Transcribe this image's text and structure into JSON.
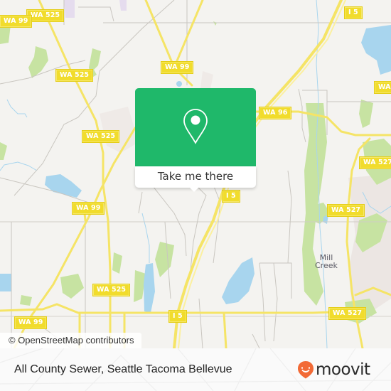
{
  "map": {
    "colors": {
      "background": "#f4f3f0",
      "water": "#a8d5ee",
      "park": "#c7e3a2",
      "major_road": "#f5e466",
      "minor_road": "#c9c6c0",
      "urban": "#ece6e3",
      "label_bg": "#f1dc2c"
    },
    "road_labels": [
      {
        "id": "wa525-top",
        "text": "WA 525"
      },
      {
        "id": "wa99-top",
        "text": "WA 99"
      },
      {
        "id": "i5-top",
        "text": "I 5"
      },
      {
        "id": "wa525-mid",
        "text": "WA 525"
      },
      {
        "id": "wa99-mid",
        "text": "WA 99"
      },
      {
        "id": "wa-right",
        "text": "WA"
      },
      {
        "id": "wa96",
        "text": "WA 96"
      },
      {
        "id": "wa525-lower",
        "text": "WA 525"
      },
      {
        "id": "wa527-upper",
        "text": "WA 527"
      },
      {
        "id": "i5-mid",
        "text": "I 5"
      },
      {
        "id": "wa99-left",
        "text": "WA 99"
      },
      {
        "id": "wa527-mid",
        "text": "WA 527"
      },
      {
        "id": "wa525-bottom",
        "text": "WA 525"
      },
      {
        "id": "wa99-bottom",
        "text": "WA 99"
      },
      {
        "id": "i5-bottom",
        "text": "I 5"
      },
      {
        "id": "wa527-bottom",
        "text": "WA 527"
      }
    ],
    "place_labels": [
      {
        "id": "mill-creek",
        "line1": "Mill",
        "line2": "Creek"
      }
    ],
    "attribution": "© OpenStreetMap contributors"
  },
  "popup": {
    "icon": "map-pin-icon",
    "button_label": "Take me there",
    "color": "#1fb86a"
  },
  "footer": {
    "business_name": "All County Sewer, Seattle Tacoma Bellevue",
    "brand": {
      "name": "moovit",
      "icon": "moovit-smile-pin-icon",
      "color": "#f26a36"
    }
  }
}
